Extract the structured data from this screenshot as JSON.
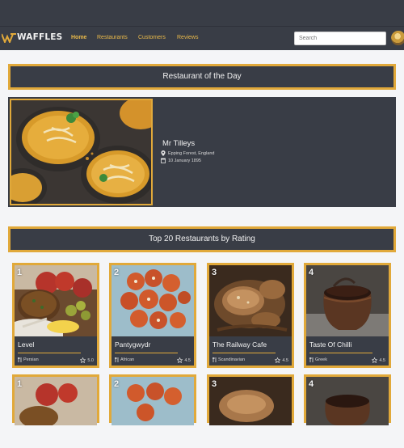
{
  "header": {
    "brand": "WAFFLES",
    "nav": [
      "Home",
      "Restaurants",
      "Customers",
      "Reviews"
    ],
    "search_placeholder": "Search",
    "accent": "#e1a93a",
    "bar_color": "#393d46"
  },
  "restaurant_of_the_day": {
    "heading": "Restaurant of the Day",
    "name": "Mr Tilleys",
    "location": "Epping Forest, England",
    "date": "10 January 1895",
    "icons": [
      "map-pin-icon",
      "calendar-icon"
    ]
  },
  "top_restaurants": {
    "heading": "Top 20 Restaurants by Rating",
    "cards": [
      {
        "rank": "1",
        "name": "Level",
        "cuisine": "Persian",
        "rating": "5.0"
      },
      {
        "rank": "2",
        "name": "Pantygwydr",
        "cuisine": "African",
        "rating": "4.5"
      },
      {
        "rank": "3",
        "name": "The Railway Cafe",
        "cuisine": "Scandinavian",
        "rating": "4.5"
      },
      {
        "rank": "4",
        "name": "Taste Of Chilli",
        "cuisine": "Greek",
        "rating": "4.5"
      }
    ],
    "next_row_ranks": [
      "1",
      "2",
      "3",
      "4"
    ]
  }
}
